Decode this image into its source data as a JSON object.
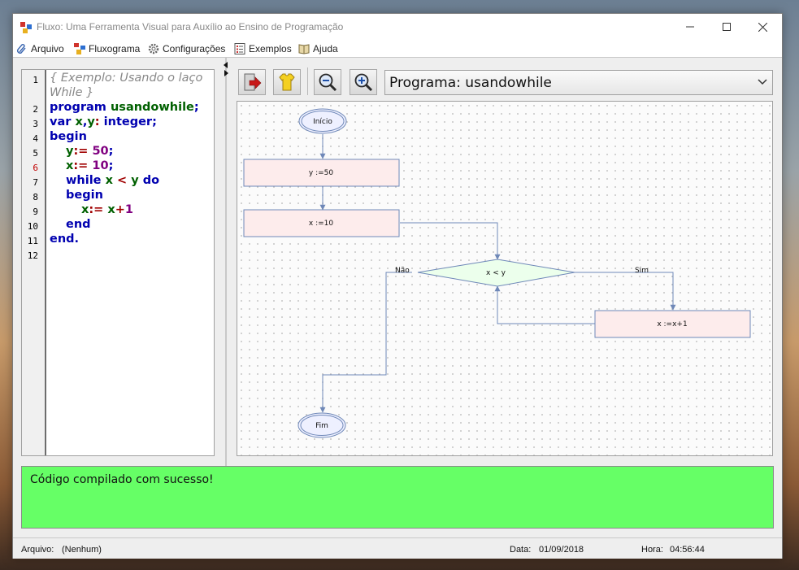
{
  "window": {
    "title": "Fluxo: Uma Ferramenta Visual para Auxílio ao Ensino de Programação"
  },
  "menu": {
    "items": [
      {
        "label": "Arquivo",
        "icon": "paperclip-icon"
      },
      {
        "label": "Fluxograma",
        "icon": "flowchart-icon"
      },
      {
        "label": "Configurações",
        "icon": "gear-icon"
      },
      {
        "label": "Exemplos",
        "icon": "list-icon"
      },
      {
        "label": "Ajuda",
        "icon": "book-icon"
      }
    ]
  },
  "editor": {
    "line_numbers": [
      "1",
      "",
      "2",
      "3",
      "4",
      "5",
      "6",
      "7",
      "8",
      "9",
      "10",
      "11",
      "12"
    ],
    "code": {
      "l1a": "{ Exemplo: Usando o laço",
      "l1b": "While }",
      "l2": [
        "program",
        "usandowhile",
        ";"
      ],
      "l3": [
        "var",
        "x",
        ",",
        "y",
        ":",
        "integer",
        ";"
      ],
      "l4": "begin",
      "l5": [
        "y",
        ":=",
        "50",
        ";"
      ],
      "l6": [
        "x",
        ":=",
        "10",
        ";"
      ],
      "l7": [
        "while",
        "x",
        "<",
        "y",
        "do"
      ],
      "l8": "begin",
      "l9": [
        "x",
        ":=",
        "x",
        "+",
        "1"
      ],
      "l10": "end",
      "l11": [
        "end",
        "."
      ]
    }
  },
  "toolbar": {
    "buttons": [
      {
        "name": "exit-button",
        "icon": "exit-arrow-icon"
      },
      {
        "name": "shirt-button",
        "icon": "shirt-icon"
      },
      {
        "name": "zoom-out-button",
        "icon": "zoom-out-icon"
      },
      {
        "name": "zoom-in-button",
        "icon": "zoom-in-icon"
      }
    ],
    "program_select": "Programa: usandowhile"
  },
  "flowchart": {
    "start": "Início",
    "end": "Fim",
    "steps": [
      "y :=50",
      "x :=10",
      "x :=x+1"
    ],
    "decision": "x < y",
    "yes_label": "Sim",
    "no_label": "Não",
    "colors": {
      "process_fill": "#fdecec",
      "decision_fill": "#ecffec",
      "terminal_fill": "#eef0ff",
      "stroke": "#6f88b8"
    }
  },
  "console": {
    "message": "Código compilado com sucesso!",
    "color": "#66ff66"
  },
  "status": {
    "file_label": "Arquivo:",
    "file_value": "(Nenhum)",
    "date_label": "Data:",
    "date_value": "01/09/2018",
    "time_label": "Hora:",
    "time_value": "04:56:44"
  }
}
